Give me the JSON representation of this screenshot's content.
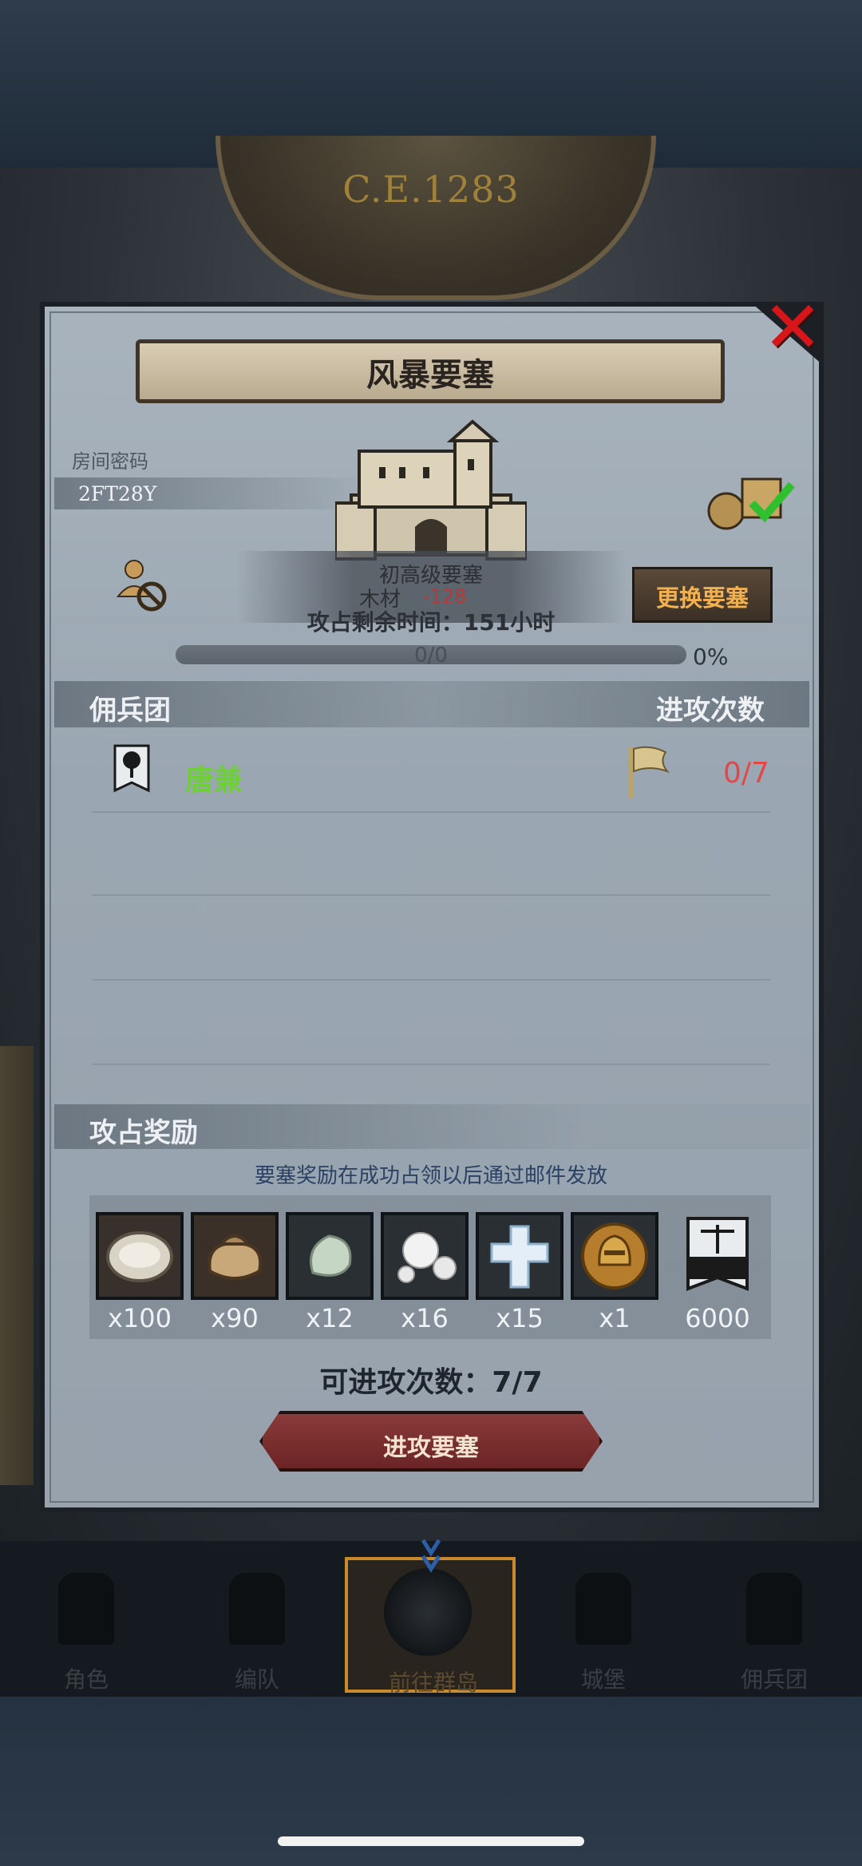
{
  "header": {
    "era": "C.E.1283"
  },
  "dialog": {
    "title": "风暴要塞",
    "close_icon": "close-icon",
    "room_label": "房间密码",
    "room_code": "2FT28Y",
    "fort_level": "初高级要塞",
    "resource_name": "木材",
    "resource_value": "-128",
    "time_remaining": "攻占剩余时间：151小时",
    "switch_button": "更换要塞",
    "progress_text": "0/0",
    "progress_percent": "0%",
    "progress_value": 0,
    "columns": {
      "mercenary": "佣兵团",
      "attacks": "进攻次数"
    },
    "rows": [
      {
        "name": "唐兼",
        "attack_count": "0/7",
        "emblem": "tree-emblem-icon",
        "flag": "flag-icon"
      }
    ],
    "rewards_title": "攻占奖励",
    "rewards_note": "要塞奖励在成功占领以后通过邮件发放",
    "rewards": [
      {
        "icon": "oyster-icon",
        "qty": "x100"
      },
      {
        "icon": "sack-icon",
        "qty": "x90"
      },
      {
        "icon": "gem-stone-icon",
        "qty": "x12"
      },
      {
        "icon": "pearls-icon",
        "qty": "x16"
      },
      {
        "icon": "crystal-cross-icon",
        "qty": "x15"
      },
      {
        "icon": "helmet-coin-icon",
        "qty": "x1"
      },
      {
        "icon": "guild-banner-icon",
        "qty": "6000"
      }
    ],
    "attacks_available": "可进攻次数：7/7",
    "attack_button": "进攻要塞"
  },
  "nav": {
    "items": [
      {
        "label": "角色",
        "icon": "knight-icon"
      },
      {
        "label": "编队",
        "icon": "helmet-icon"
      },
      {
        "label": "前往群岛",
        "icon": "globe-icon",
        "active": true
      },
      {
        "label": "城堡",
        "icon": "castle-icon"
      },
      {
        "label": "佣兵团",
        "icon": "mercenary-icon"
      }
    ]
  },
  "colors": {
    "accent_green": "#6ecf39",
    "accent_red": "#e0484a",
    "accent_orange": "#f2b150",
    "active_nav": "#c98a2e"
  }
}
